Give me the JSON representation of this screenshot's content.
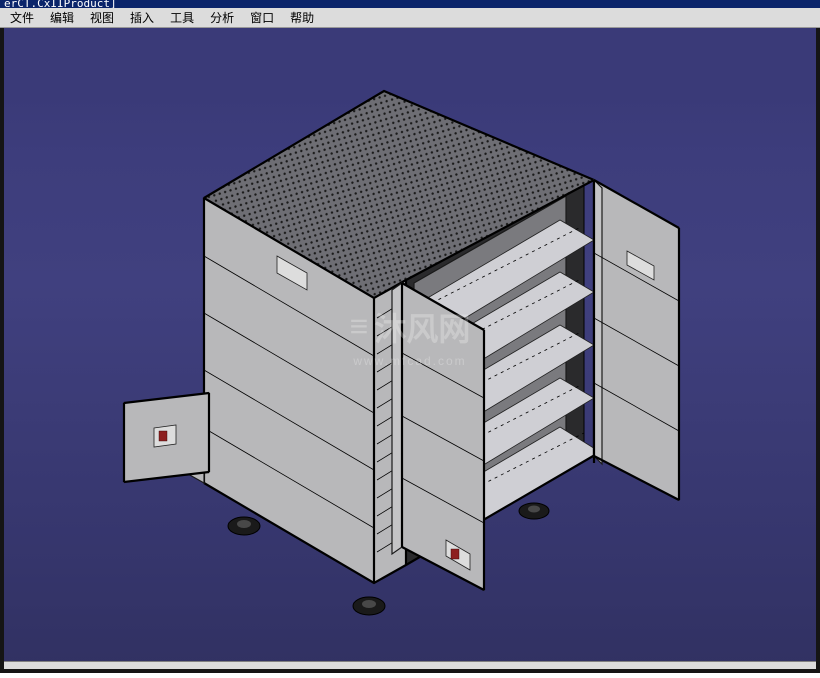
{
  "title_bar": {
    "text": "erCT.CxIIProduct]"
  },
  "menu": {
    "items": [
      {
        "label": "文件"
      },
      {
        "label": "编辑"
      },
      {
        "label": "视图"
      },
      {
        "label": "插入"
      },
      {
        "label": "工具"
      },
      {
        "label": "分析"
      },
      {
        "label": "窗口"
      },
      {
        "label": "帮助"
      }
    ]
  },
  "watermark": {
    "logo_glyph": "≡",
    "main": "沐风网",
    "sub": "www.mfcad.com"
  },
  "model": {
    "description": "mobile-tool-cabinet-isometric",
    "doors_open": true
  }
}
